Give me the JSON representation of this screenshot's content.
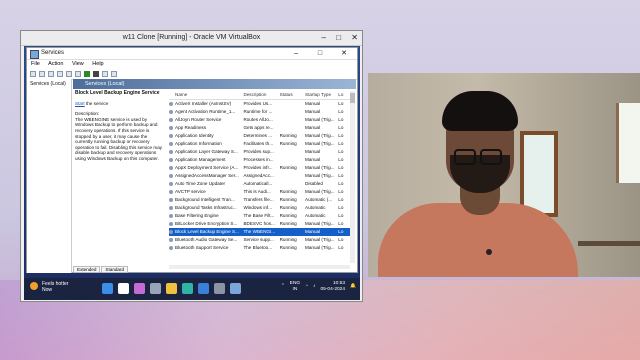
{
  "vbox": {
    "title": "w11 Clone [Running] - Oracle VM VirtualBox",
    "min": "–",
    "max": "□",
    "close": "✕"
  },
  "services": {
    "window_title": "Services",
    "controls": {
      "min": "–",
      "max": "□",
      "close": "✕"
    },
    "menu": [
      "File",
      "Action",
      "View",
      "Help"
    ],
    "nav_node": "Services (Local)",
    "header": "Services (Local)",
    "selected_service": "Block Level Backup Engine Service",
    "start_link": "Start",
    "start_suffix": " the service",
    "description_label": "Description:",
    "description": "The WBENGINE service is used by Windows Backup to perform backup and recovery operations. If this service is stopped by a user, it may cause the currently running backup or recovery operation to fail. Disabling this service may disable backup and recovery operations using Windows Backup on this computer.",
    "columns": [
      "Name",
      "Description",
      "Status",
      "Startup Type",
      "Lo"
    ],
    "rows": [
      [
        "ActiveX Installer (AxInstSV)",
        "Provides Us...",
        "",
        "Manual",
        "Lo"
      ],
      [
        "Agent Activation Runtime_1...",
        "Runtime for ...",
        "",
        "Manual",
        "Lo"
      ],
      [
        "AllJoyn Router Service",
        "Routes AllJo...",
        "",
        "Manual (Trig...",
        "Lo"
      ],
      [
        "App Readiness",
        "Gets apps re...",
        "",
        "Manual",
        "Lo"
      ],
      [
        "Application Identity",
        "Determines ...",
        "Running",
        "Manual (Trig...",
        "Lo"
      ],
      [
        "Application Information",
        "Facilitates th...",
        "Running",
        "Manual (Trig...",
        "Lo"
      ],
      [
        "Application Layer Gateway S...",
        "Provides sup...",
        "",
        "Manual",
        "Lo"
      ],
      [
        "Application Management",
        "Processes in...",
        "",
        "Manual",
        "Lo"
      ],
      [
        "AppX Deployment Service (A...",
        "Provides infr...",
        "Running",
        "Manual (Trig...",
        "Lo"
      ],
      [
        "AssignedAccessManager Ser...",
        "AssignedAcc...",
        "",
        "Manual (Trig...",
        "Lo"
      ],
      [
        "Auto Time Zone Updater",
        "Automaticall...",
        "",
        "Disabled",
        "Lo"
      ],
      [
        "AVCTP service",
        "This is Audi...",
        "Running",
        "Manual (Trig...",
        "Lo"
      ],
      [
        "Background Intelligent Tran...",
        "Transfers file...",
        "Running",
        "Automatic (...",
        "Lo"
      ],
      [
        "Background Tasks Infrastruc...",
        "Windows inf...",
        "Running",
        "Automatic",
        "Lo"
      ],
      [
        "Base Filtering Engine",
        "The Base Filt...",
        "Running",
        "Automatic",
        "Lo"
      ],
      [
        "BitLocker Drive Encryption S...",
        "BDESVC hos...",
        "Running",
        "Manual (Trig...",
        "Lo"
      ],
      [
        "Block Level Backup Engine S...",
        "The WBENGI...",
        "",
        "Manual",
        "Lo"
      ],
      [
        "Bluetooth Audio Gateway Se...",
        "Service supp...",
        "Running",
        "Manual (Trig...",
        "Lo"
      ],
      [
        "Bluetooth Support Service",
        "The Bluetoo...",
        "Running",
        "Manual (Trig...",
        "Lo"
      ]
    ],
    "selected_index": 16,
    "tabs": [
      "Extended",
      "Standard"
    ]
  },
  "taskbar": {
    "weather_title": "Feels hotter",
    "weather_sub": "Now",
    "apps": [
      {
        "name": "windows-start-icon",
        "color": "#3b8ee8"
      },
      {
        "name": "search-icon",
        "color": "#ffffff"
      },
      {
        "name": "copilot-icon",
        "color": "#c66bd6"
      },
      {
        "name": "task-view-icon",
        "color": "#9aa4b8"
      },
      {
        "name": "file-explorer-icon",
        "color": "#f0c040"
      },
      {
        "name": "edge-icon",
        "color": "#2fb3a6"
      },
      {
        "name": "store-icon",
        "color": "#3a7fd8"
      },
      {
        "name": "settings-icon",
        "color": "#8a94a6"
      },
      {
        "name": "services-icon",
        "color": "#7aa6d8"
      }
    ],
    "lang_top": "ENG",
    "lang_bottom": "IN",
    "time": "10:53",
    "date": "05-04-2024"
  }
}
